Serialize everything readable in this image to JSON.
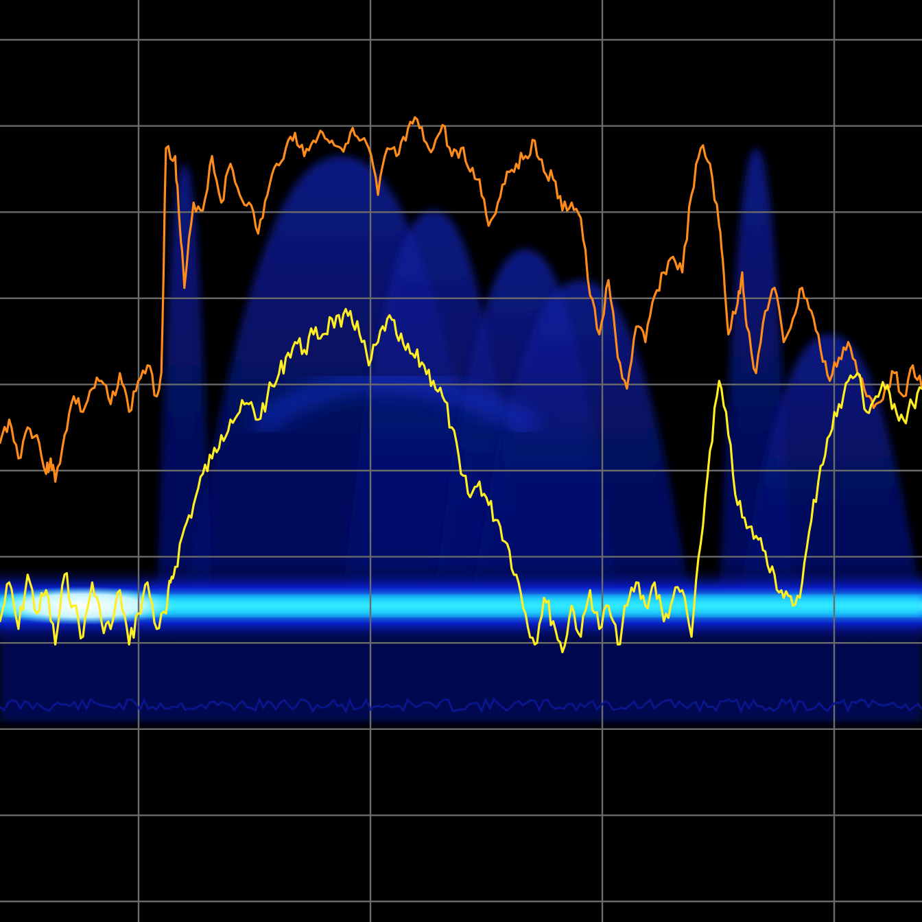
{
  "colors": {
    "background": "#000000",
    "grid": "#6b6b6b",
    "max_hold_trace": "#ff8c1a",
    "live_trace": "#ffee22",
    "density_low": "#04106a",
    "density_mid": "#1838e8",
    "density_high": "#22e6ff",
    "density_peak": "#ffffff"
  },
  "grid": {
    "vertical_divisions": 4,
    "horizontal_divisions": 10
  },
  "chart_data": {
    "type": "line",
    "title": "",
    "xlabel": "",
    "ylabel": "",
    "x_range": [
      0,
      100
    ],
    "y_range": [
      0,
      100
    ],
    "grid": true,
    "series": [
      {
        "role": "max-hold",
        "color": "#ff8c1a",
        "x": [
          0,
          1,
          2,
          3,
          4,
          5,
          5.5,
          6,
          7,
          8,
          9,
          10,
          11,
          12,
          13,
          14,
          15,
          16,
          17,
          17.5,
          18,
          19,
          19.5,
          20,
          21,
          22,
          23,
          24,
          25,
          26,
          27,
          28,
          29,
          30,
          31,
          32,
          33,
          34,
          35,
          36,
          37,
          38,
          39,
          40,
          41,
          42,
          43,
          44,
          45,
          46,
          47,
          48,
          49,
          50,
          51,
          52,
          53,
          54,
          55,
          56,
          57,
          58,
          59,
          60,
          61,
          62,
          63,
          64,
          65,
          66,
          67,
          68,
          69,
          70,
          71,
          72,
          73,
          74,
          75,
          76,
          77,
          78,
          78.5,
          79,
          80,
          80.5,
          81,
          82,
          83,
          84,
          85,
          86,
          87,
          88,
          89,
          90,
          91,
          92,
          93,
          94,
          95,
          96,
          97,
          98,
          99,
          100
        ],
        "y": [
          48,
          51,
          46,
          50,
          49,
          44,
          46,
          43,
          49,
          54,
          52,
          55,
          56,
          53,
          57,
          52,
          56,
          58,
          54,
          57,
          86,
          85,
          76,
          68,
          79,
          78,
          85,
          79,
          84,
          80,
          79,
          75,
          80,
          84,
          86,
          88,
          85,
          87,
          88,
          87,
          86,
          88,
          87,
          86,
          80,
          86,
          85,
          87,
          90,
          87,
          86,
          89,
          85,
          86,
          83,
          82,
          76,
          79,
          83,
          84,
          85,
          87,
          83,
          82,
          78,
          79,
          77,
          67,
          62,
          69,
          59,
          55,
          63,
          61,
          67,
          70,
          72,
          70,
          80,
          86,
          84,
          76,
          70,
          62,
          66,
          70,
          63,
          57,
          65,
          68,
          61,
          64,
          68,
          65,
          60,
          56,
          59,
          61,
          57,
          54,
          53,
          55,
          57,
          54,
          58,
          55
        ],
        "note_unused": ""
      },
      {
        "role": "live",
        "color": "#ffee22",
        "x": [
          0,
          1,
          2,
          3,
          4,
          5,
          6,
          7,
          8,
          9,
          10,
          11,
          12,
          13,
          14,
          15,
          16,
          17,
          18,
          18.5,
          19,
          20,
          21,
          22,
          23,
          24,
          25,
          26,
          27,
          28,
          29,
          30,
          31,
          32,
          33,
          34,
          35,
          36,
          37,
          38,
          39,
          40,
          41,
          42,
          43,
          44,
          45,
          46,
          47,
          48,
          49,
          50,
          51,
          52,
          53,
          54,
          55,
          56,
          57,
          58,
          59,
          60,
          61,
          62,
          63,
          64,
          65,
          66,
          67,
          68,
          69,
          70,
          71,
          72,
          73,
          74,
          75,
          76,
          77,
          78,
          79,
          80,
          81,
          82,
          83,
          84,
          85,
          86,
          87,
          88,
          89,
          90,
          91,
          92,
          93,
          94,
          95,
          96,
          97,
          98,
          99,
          100
        ],
        "y": [
          25,
          30,
          24,
          31,
          26,
          29,
          22,
          31,
          27,
          23,
          30,
          25,
          24,
          29,
          22,
          26,
          30,
          24,
          26,
          30,
          32,
          37,
          40,
          44,
          46,
          49,
          51,
          52,
          53,
          51,
          54,
          56,
          59,
          61,
          60,
          62,
          62,
          64,
          63,
          65,
          62,
          58,
          61,
          64,
          62,
          60,
          59,
          58,
          56,
          54,
          50,
          44,
          41,
          43,
          40,
          38,
          35,
          31,
          26,
          22,
          28,
          25,
          21,
          27,
          23,
          29,
          24,
          27,
          22,
          27,
          30,
          27,
          30,
          25,
          28,
          29,
          23,
          35,
          47,
          56,
          49,
          40,
          37,
          36,
          34,
          31,
          28,
          27,
          30,
          38,
          45,
          49,
          53,
          56,
          57,
          52,
          54,
          55,
          53,
          51,
          53,
          55
        ],
        "note_unused": ""
      }
    ],
    "density": {
      "type": "heatmap",
      "floor_band_level": 27,
      "floor_band_peak_left": [
        0,
        18
      ],
      "envelopes": [
        {
          "center": 37,
          "width": 17,
          "top": 85
        },
        {
          "center": 47,
          "width": 10,
          "top": 78
        },
        {
          "center": 57,
          "width": 10,
          "top": 73
        },
        {
          "center": 63,
          "width": 12,
          "top": 69
        },
        {
          "center": 82,
          "width": 4,
          "top": 86
        },
        {
          "center": 20,
          "width": 3,
          "top": 84
        },
        {
          "center": 90,
          "width": 10,
          "top": 62
        }
      ]
    }
  }
}
